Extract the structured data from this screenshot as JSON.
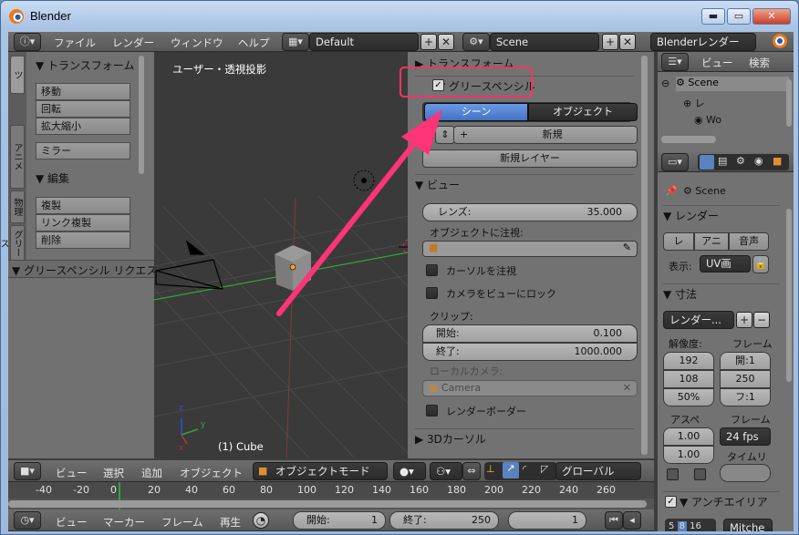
{
  "window": {
    "title": "Blender",
    "minimize": "▬",
    "maximize": "▭",
    "close": "✕"
  },
  "info_header": {
    "menus": [
      "ファイル",
      "レンダー",
      "ウィンドウ",
      "ヘルプ"
    ],
    "layout": "Default",
    "scene": "Scene",
    "engine": "Blenderレンダー"
  },
  "toolshelf": {
    "tabs": [
      "ツ",
      "アニメ",
      "物理",
      "グリース"
    ],
    "transform_title": "▼ トランスフォーム",
    "transform_buttons": [
      "移動",
      "回転",
      "拡大縮小"
    ],
    "mirror": "ミラー",
    "edit_title": "▼ 編集",
    "edit_buttons": [
      "複製",
      "リンク複製",
      "削除"
    ],
    "grease_title": "▼ グリースペンシル リクエスト"
  },
  "viewport": {
    "label": "ユーザー・透視投影",
    "object_label": "(1) Cube",
    "axis_x": "x",
    "axis_y": "y",
    "axis_z": "z"
  },
  "npanel": {
    "transform": "▶ トランスフォーム",
    "grease": "▼ グリースペンシル",
    "scene_btn": "シーン",
    "object_btn": "オブジェクト",
    "new_btn": "新規",
    "new_layer": "新規レイヤー",
    "view": "▼ ビュー",
    "lens_label": "レンズ:",
    "lens_value": "35.000",
    "lock_object": "オブジェクトに注視:",
    "lock_cursor": "カーソルを注視",
    "lock_camera": "カメラをビューにロック",
    "clip": "クリップ:",
    "clip_start_label": "開始:",
    "clip_start": "0.100",
    "clip_end_label": "終了:",
    "clip_end": "1000.000",
    "local_camera": "ローカルカメラ:",
    "camera": "Camera",
    "render_border": "レンダーボーダー",
    "cursor": "▶ 3Dカーソル"
  },
  "outliner": {
    "menus": [
      "ビュー",
      "検索"
    ],
    "items": [
      "Scene",
      "レ",
      "Wo"
    ]
  },
  "properties": {
    "scene": "Scene",
    "render": "▼ レンダー",
    "render_btns": [
      "レ",
      "アニ",
      "音声"
    ],
    "display_label": "表示:",
    "display_value": "UV画",
    "dimensions": "▼ 寸法",
    "preset": "レンダー...",
    "resolution": "解像度:",
    "frames": "フレーム",
    "res_x": "192",
    "res_y": "108",
    "res_pct": "50%",
    "start": "開:1",
    "end": "250",
    "step": "フ:1",
    "aspect": "アスペ",
    "frame_rate_label": "フレーム",
    "asp_x": "1.00",
    "asp_y": "1.00",
    "fps": "24 fps",
    "time_remap": "タイムリ",
    "anti": "▼ アンチエイリア",
    "aa_vals": [
      "5",
      "8",
      "16"
    ],
    "aa_filter": "Mitche"
  },
  "view3d_header": {
    "menus": [
      "ビュー",
      "選択",
      "追加",
      "オブジェクト"
    ],
    "mode": "オブジェクトモード",
    "orientation": "グローバル"
  },
  "timeline": {
    "ticks": [
      "-40",
      "-20",
      "0",
      "20",
      "40",
      "60",
      "80",
      "100",
      "120",
      "140",
      "160",
      "180",
      "200",
      "220",
      "240",
      "260"
    ]
  },
  "timeline_header": {
    "menus": [
      "ビュー",
      "マーカー",
      "フレーム",
      "再生"
    ],
    "start_label": "開始:",
    "start": "1",
    "end_label": "終了:",
    "end": "250",
    "current": "1"
  }
}
